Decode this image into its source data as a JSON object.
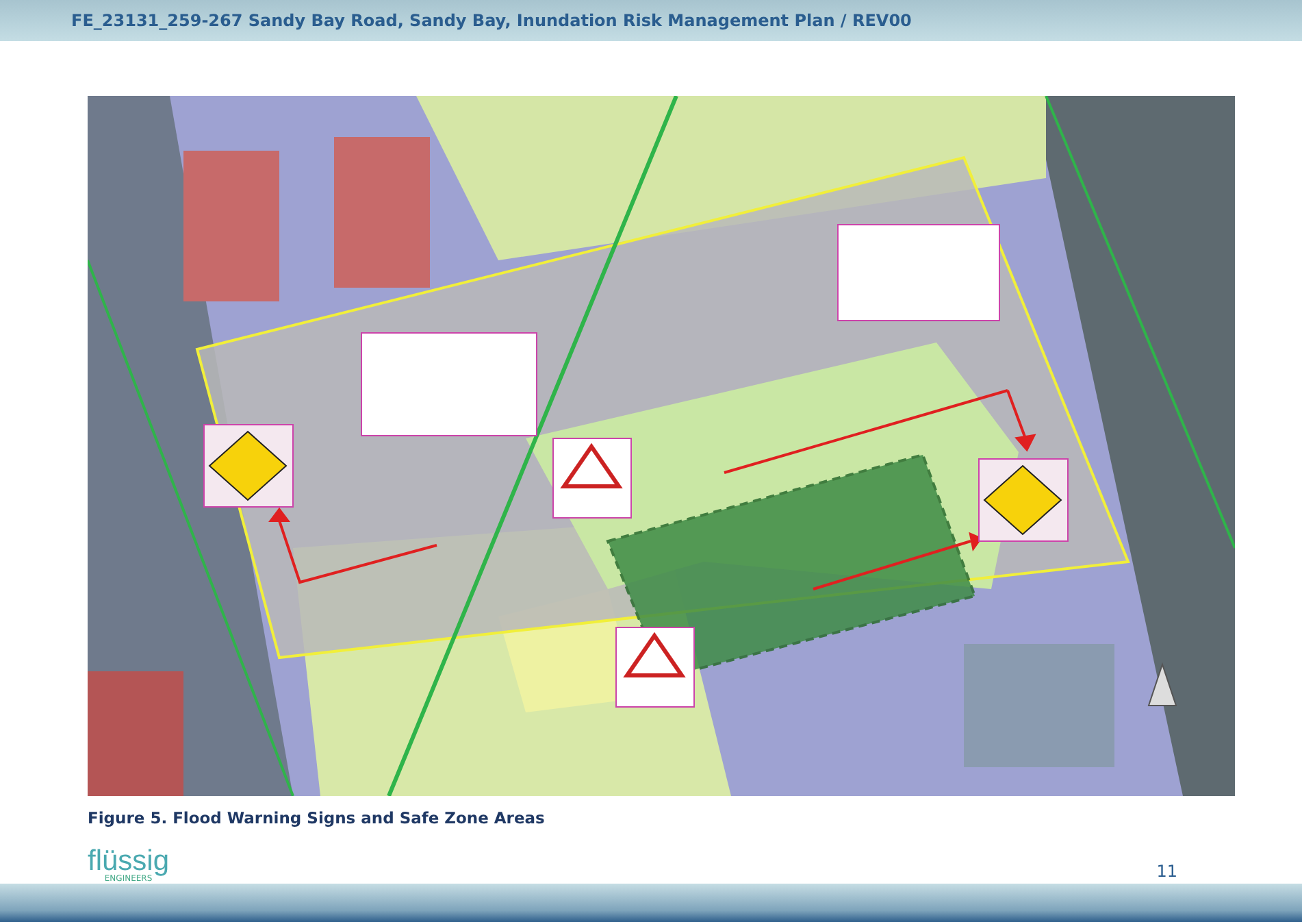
{
  "header": {
    "title": "FE_23131_259-267 Sandy Bay Road, Sandy Bay, Inundation Risk Management Plan / REV00"
  },
  "figure": {
    "caption": "Figure 5. Flood Warning Signs and Safe Zone Areas"
  },
  "footer": {
    "logo_text": "flüssig",
    "logo_subtext": "ENGINEERS",
    "page_number": "11"
  }
}
